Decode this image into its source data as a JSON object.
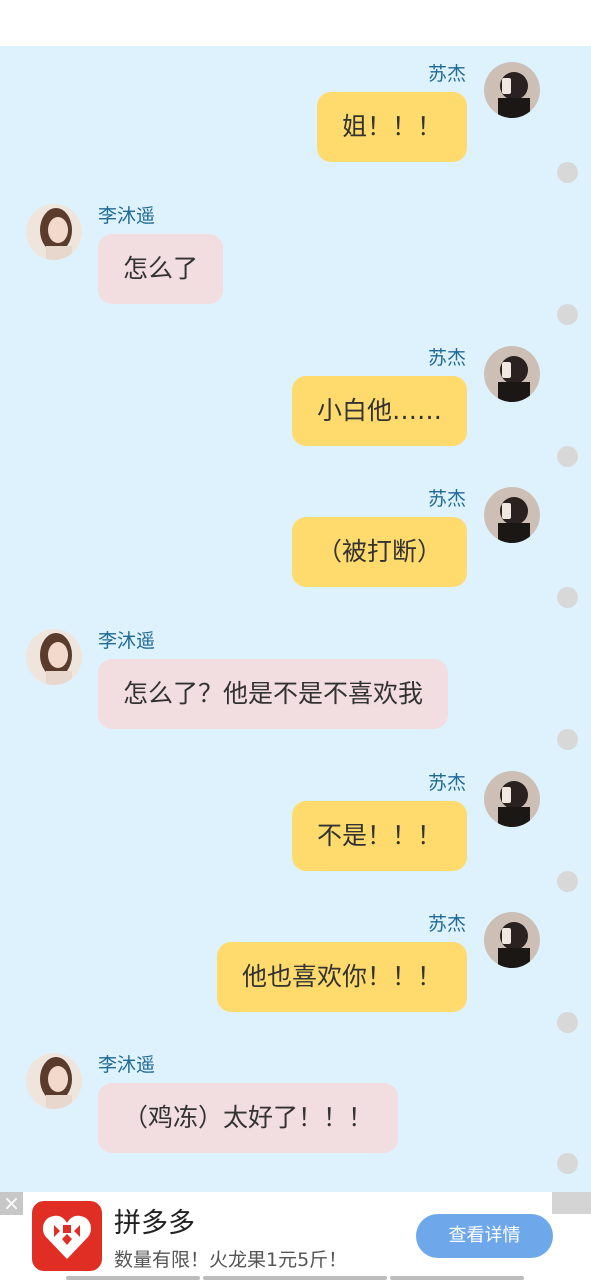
{
  "messages": [
    {
      "side": "right",
      "name": "苏杰",
      "text": "姐！！！",
      "avatar": "male-avatar"
    },
    {
      "side": "left",
      "name": "李沐遥",
      "text": "怎么了",
      "avatar": "female-avatar"
    },
    {
      "side": "right",
      "name": "苏杰",
      "text": "小白他……",
      "avatar": "male-avatar"
    },
    {
      "side": "right",
      "name": "苏杰",
      "text": "（被打断）",
      "avatar": "male-avatar"
    },
    {
      "side": "left",
      "name": "李沐遥",
      "text": "怎么了？他是不是不喜欢我",
      "avatar": "female-avatar"
    },
    {
      "side": "right",
      "name": "苏杰",
      "text": "不是！！！",
      "avatar": "male-avatar"
    },
    {
      "side": "right",
      "name": "苏杰",
      "text": "他也喜欢你！！！",
      "avatar": "male-avatar"
    },
    {
      "side": "left",
      "name": "李沐遥",
      "text": "（鸡冻）太好了！！！",
      "avatar": "female-avatar"
    }
  ],
  "ad": {
    "close_label": "×",
    "app_name": "拼多多",
    "tagline": "数量有限！火龙果1元5斤！",
    "button_label": "查看详情",
    "logo_icon": "pinduoduo-logo-icon",
    "button_color": "#6fa8ea",
    "logo_color": "#e02e24"
  },
  "colors": {
    "chat_background": "#ddf2fc",
    "right_bubble": "#fedb6c",
    "left_bubble": "#f2dde0",
    "name_color": "#1f6a96"
  }
}
